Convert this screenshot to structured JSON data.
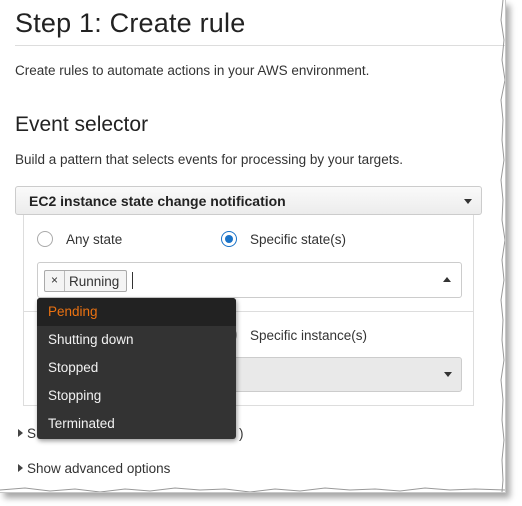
{
  "header": {
    "title": "Step 1: Create rule",
    "intro": "Create rules to automate actions in your AWS environment."
  },
  "event_selector": {
    "heading": "Event selector",
    "description": "Build a pattern that selects events for processing by your targets.",
    "event_type": "EC2 instance state change notification",
    "state_options": {
      "any_label": "Any state",
      "specific_label": "Specific state(s)",
      "selected": "Specific state(s)"
    },
    "selected_states": [
      {
        "remove": "×",
        "label": "Running"
      }
    ],
    "dropdown_options": [
      "Pending",
      "Shutting down",
      "Stopped",
      "Stopping",
      "Terminated"
    ],
    "highlighted_option": "Pending",
    "instance_options": {
      "specific_label": "Specific instance(s)"
    },
    "hidden_link_fragments": {
      "left": "S",
      "right": ")"
    },
    "advanced_link": "Show advanced options"
  },
  "colors": {
    "accent_orange": "#ec7211",
    "radio_blue": "#1a73c8",
    "dropdown_bg": "#333333"
  },
  "icons": {
    "event_select_caret": "caret-down-icon",
    "state_box_caret": "caret-up-icon",
    "instance_select_caret": "caret-down-icon",
    "expand_triangle": "triangle-right-icon"
  }
}
